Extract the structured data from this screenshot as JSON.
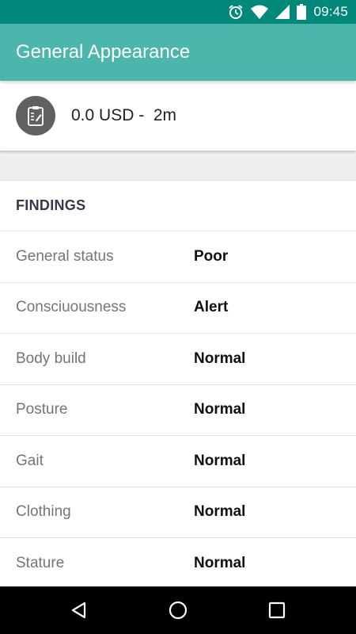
{
  "status_bar": {
    "time": "09:45",
    "icons": [
      "alarm-icon",
      "wifi-icon",
      "signal-icon",
      "battery-icon"
    ]
  },
  "app_bar": {
    "title": "General Appearance"
  },
  "summary": {
    "icon": "clipboard-icon",
    "cost": "0.0 USD",
    "separator": " -  ",
    "duration": "2m"
  },
  "findings": {
    "header": "FINDINGS",
    "rows": [
      {
        "label": "General status",
        "value": "Poor"
      },
      {
        "label": "Consciuousness",
        "value": "Alert"
      },
      {
        "label": "Body build",
        "value": "Normal"
      },
      {
        "label": "Posture",
        "value": "Normal"
      },
      {
        "label": "Gait",
        "value": "Normal"
      },
      {
        "label": "Clothing",
        "value": "Normal"
      },
      {
        "label": "Stature",
        "value": "Normal"
      }
    ]
  },
  "nav_bar": {
    "buttons": [
      "back-icon",
      "home-icon",
      "recents-icon"
    ]
  },
  "colors": {
    "status_bar": "#00897b",
    "app_bar": "#4db6ac",
    "background": "#eeeeee",
    "nav_bar": "#000000"
  }
}
